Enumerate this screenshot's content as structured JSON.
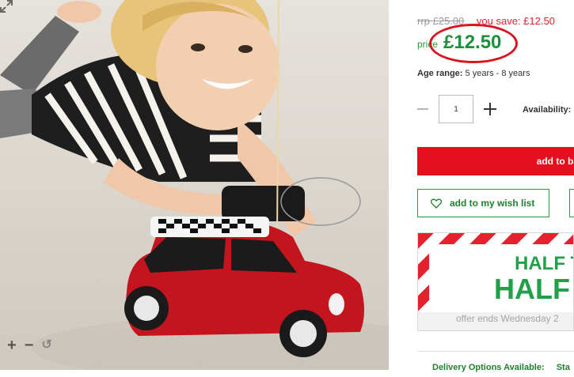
{
  "pricing": {
    "rrp": "rrp £25.00",
    "you_save": "you save: £12.50",
    "price_label": "price",
    "price": "£12.50"
  },
  "age_range": {
    "label": "Age range:",
    "value": "5 years - 8 years"
  },
  "quantity": {
    "value": "1",
    "availability_label": "Availability:"
  },
  "buttons": {
    "add_to_basket": "add to ba",
    "wishlist": "add to my wish list"
  },
  "promo": {
    "line1": "HALF T",
    "line2": "HALF",
    "footer": "offer ends Wednesday 2"
  },
  "delivery": {
    "label": "Delivery Options Available:",
    "value": "Sta"
  },
  "colors": {
    "accent_red": "#e4101e",
    "brand_green": "#1e8f3a"
  }
}
